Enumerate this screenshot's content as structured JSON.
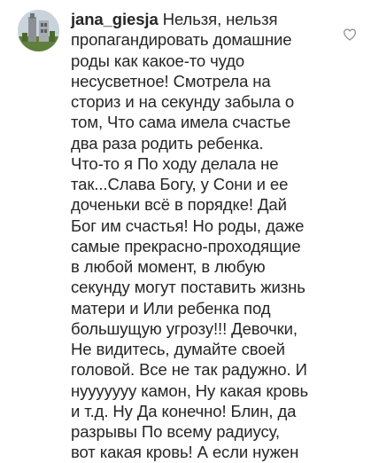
{
  "comment": {
    "username": "jana_giesja",
    "first_line_text": "Нельзя, нельзя",
    "lines": [
      "пропагандировать домашние",
      "роды как какое-то чудо",
      "несусветное! Смотрела на",
      "сториз и на секунду забыла о",
      "том, Что сама имела счастье",
      "два раза родить ребенка.",
      "Что-то я По ходу делала не",
      "так...Слава Богу, у Сони и ее",
      "доченьки всё в порядке! Дай",
      "Бог им счастья! Но роды, даже",
      "самые прекрасно-проходящие",
      "в любой момент, в любую",
      "секунду могут поставить жизнь",
      "матери и Или ребенка под",
      "большущую угрозу!!! Девочки,",
      "Не видитесь, думайте своей",
      "головой. Все не так радужно. И",
      "нууууууу камон, Ну какая кровь",
      "и т.д. Ну Да конечно! Блин, да",
      "разрывы По всему радиусу,",
      "вот какая кровь! А если нужен"
    ]
  },
  "icons": {
    "avatar": "profile-photo",
    "like": "heart-outline-icon"
  },
  "colors": {
    "text": "#262626",
    "icon": "#8e8e8e",
    "background": "#ffffff"
  }
}
